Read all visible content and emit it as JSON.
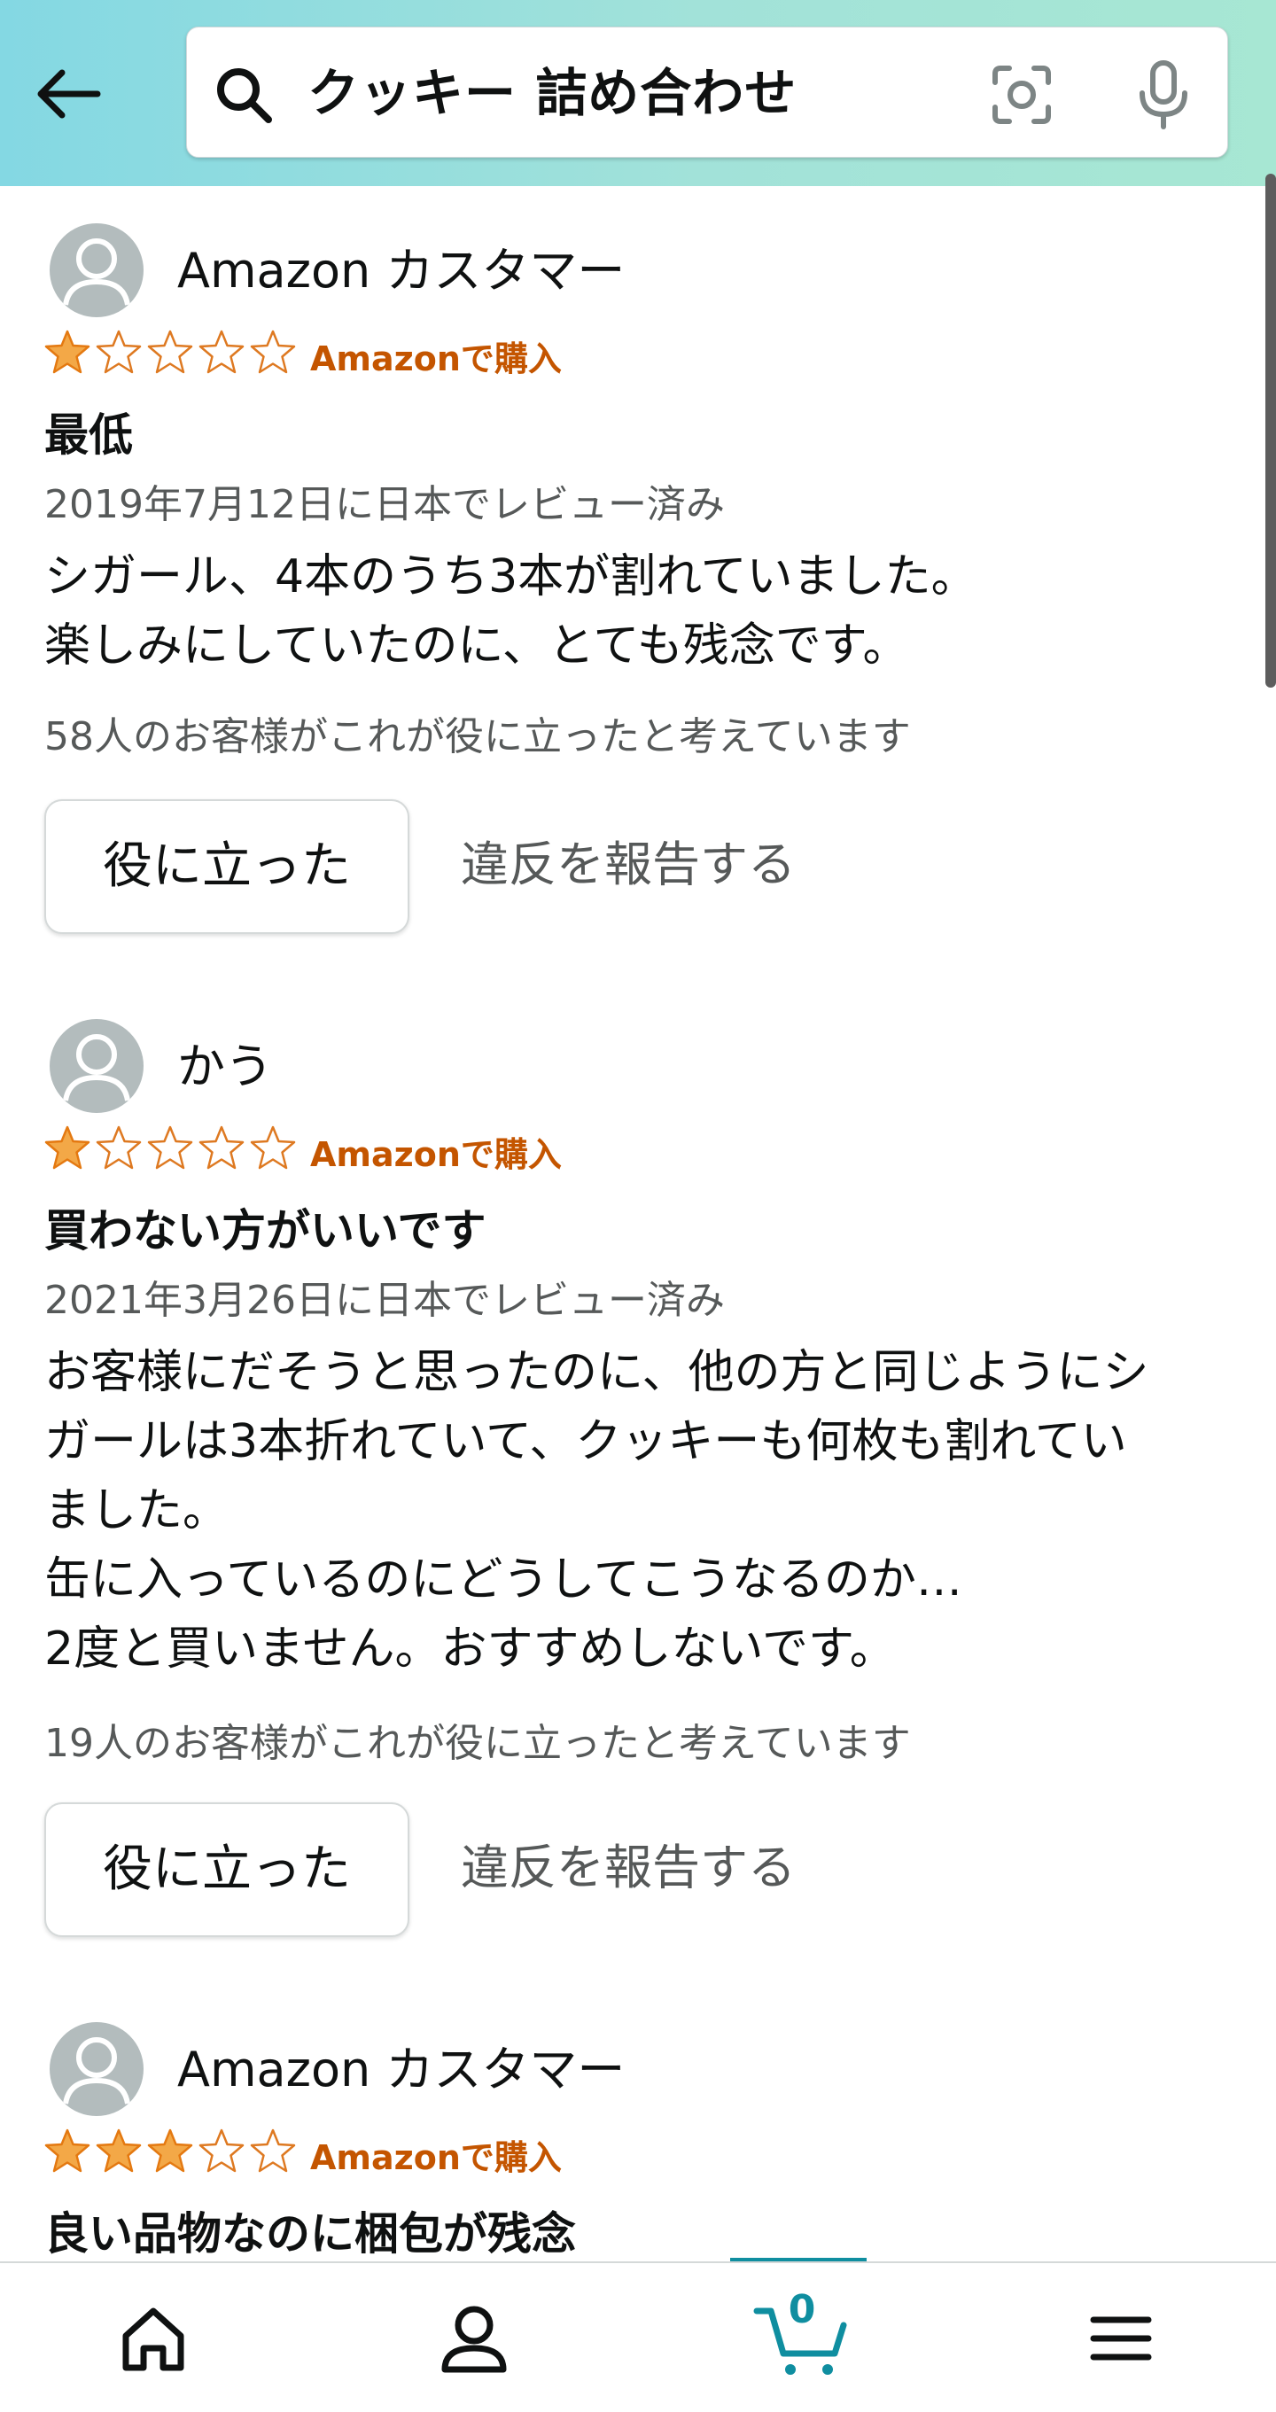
{
  "search": {
    "query": "クッキー 詰め合わせ"
  },
  "reviews": [
    {
      "reviewer": "Amazon カスタマー",
      "rating": 1,
      "rating_max": 5,
      "verified": "Amazonで購入",
      "title": "最低",
      "date": "2019年7月12日に日本でレビュー済み",
      "body": [
        "シガール、4本のうち3本が割れていました。",
        "楽しみにしていたのに、とても残念です。"
      ],
      "helpful_count": "58人のお客様がこれが役に立ったと考えています",
      "helpful_button": "役に立った",
      "report_link": "違反を報告する"
    },
    {
      "reviewer": "かう",
      "rating": 1,
      "rating_max": 5,
      "verified": "Amazonで購入",
      "title": "買わない方がいいです",
      "date": "2021年3月26日に日本でレビュー済み",
      "body": [
        "お客様にだそうと思ったのに、他の方と同じようにシ",
        "ガールは3本折れていて、クッキーも何枚も割れてい",
        "ました。",
        "缶に入っているのにどうしてこうなるのか…",
        "2度と買いません。おすすめしないです。"
      ],
      "helpful_count": "19人のお客様がこれが役に立ったと考えています",
      "helpful_button": "役に立った",
      "report_link": "違反を報告する"
    },
    {
      "reviewer": "Amazon カスタマー",
      "rating": 3,
      "rating_max": 5,
      "verified": "Amazonで購入",
      "title": "良い品物なのに梱包が残念"
    }
  ],
  "nav": {
    "cart_count": "0"
  },
  "colors": {
    "accent": "#0f8ea0",
    "star": "#f3a847",
    "verified": "#c45500"
  }
}
